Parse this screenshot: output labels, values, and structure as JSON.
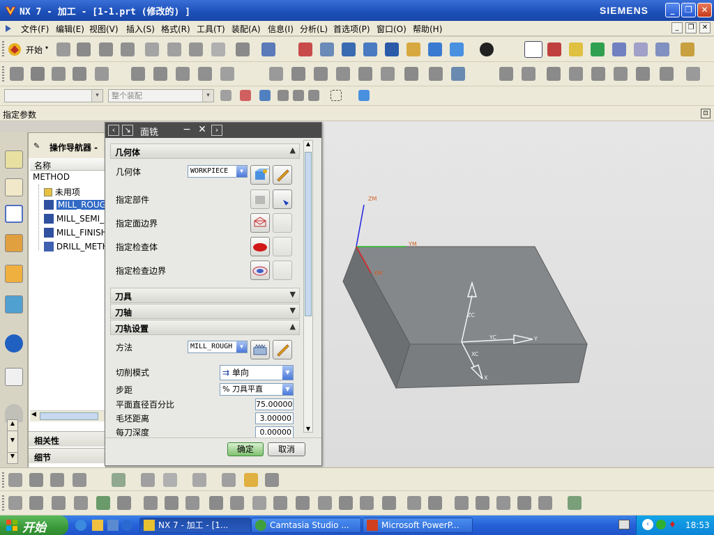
{
  "window": {
    "title": "NX 7 - 加工 - [1-1.prt  (修改的) ]",
    "brand": "SIEMENS",
    "controls": [
      "_",
      "❐",
      "✕"
    ]
  },
  "menu": {
    "items": [
      "文件(F)",
      "编辑(E)",
      "视图(V)",
      "插入(S)",
      "格式(R)",
      "工具(T)",
      "装配(A)",
      "信息(I)",
      "分析(L)",
      "首选项(P)",
      "窗口(O)",
      "帮助(H)"
    ]
  },
  "toolbar": {
    "start_label": "开始",
    "assembly_combo": "整个装配"
  },
  "param_bar": {
    "label": "指定参数"
  },
  "nav": {
    "title": "操作导航器 - ",
    "column_header": "名称",
    "items": [
      {
        "label": "METHOD",
        "selected": false
      },
      {
        "label": "未用项",
        "selected": false
      },
      {
        "label": "MILL_ROUGH",
        "selected": true
      },
      {
        "label": "MILL_SEMI_FINISH",
        "selected": false
      },
      {
        "label": "MILL_FINISH",
        "selected": false
      },
      {
        "label": "DRILL_METHOD",
        "selected": false
      }
    ],
    "bottom_sections": [
      "相关性",
      "细节"
    ]
  },
  "dialog": {
    "title": "面铣",
    "sections": {
      "geometry": "几何体",
      "tool": "刀具",
      "tool_axis": "刀轴",
      "path_settings": "刀轨设置"
    },
    "geometry_rows": {
      "geometry_label": "几何体",
      "geometry_value": "WORKPIECE",
      "part": "指定部件",
      "face_boundary": "指定面边界",
      "check_body": "指定检查体",
      "check_boundary": "指定检查边界"
    },
    "path": {
      "method_label": "方法",
      "method_value": "MILL_ROUGH",
      "cut_pattern_label": "切削模式",
      "cut_pattern_value": "单向",
      "stepover_label": "步距",
      "stepover_value": "% 刀具平直",
      "diameter_pct_label": "平面直径百分比",
      "diameter_pct_value": "75.00000",
      "blank_dist_label": "毛坯距离",
      "blank_dist_value": "3.00000",
      "depth_per_cut_label": "每刀深度",
      "depth_per_cut_value": "0.00000"
    },
    "ok_label": "确定",
    "cancel_label": "取消"
  },
  "viewport_labels": {
    "zm": "ZM",
    "ym": "YM",
    "xm": "XM",
    "zc": "ZC",
    "yc": "YC",
    "xc": "XC",
    "y": "Y",
    "x": "X"
  },
  "taskbar": {
    "start_label": "开始",
    "tasks": [
      "NX 7 - 加工 - [1...",
      "Camtasia Studio ...",
      "Microsoft PowerP..."
    ],
    "time": "18:53"
  },
  "colors": {
    "title_blue": "#1c4fb8",
    "dialog_header": "#4a4a4a",
    "block_gray": "#7a7d80",
    "selection_blue": "#316ac5"
  }
}
